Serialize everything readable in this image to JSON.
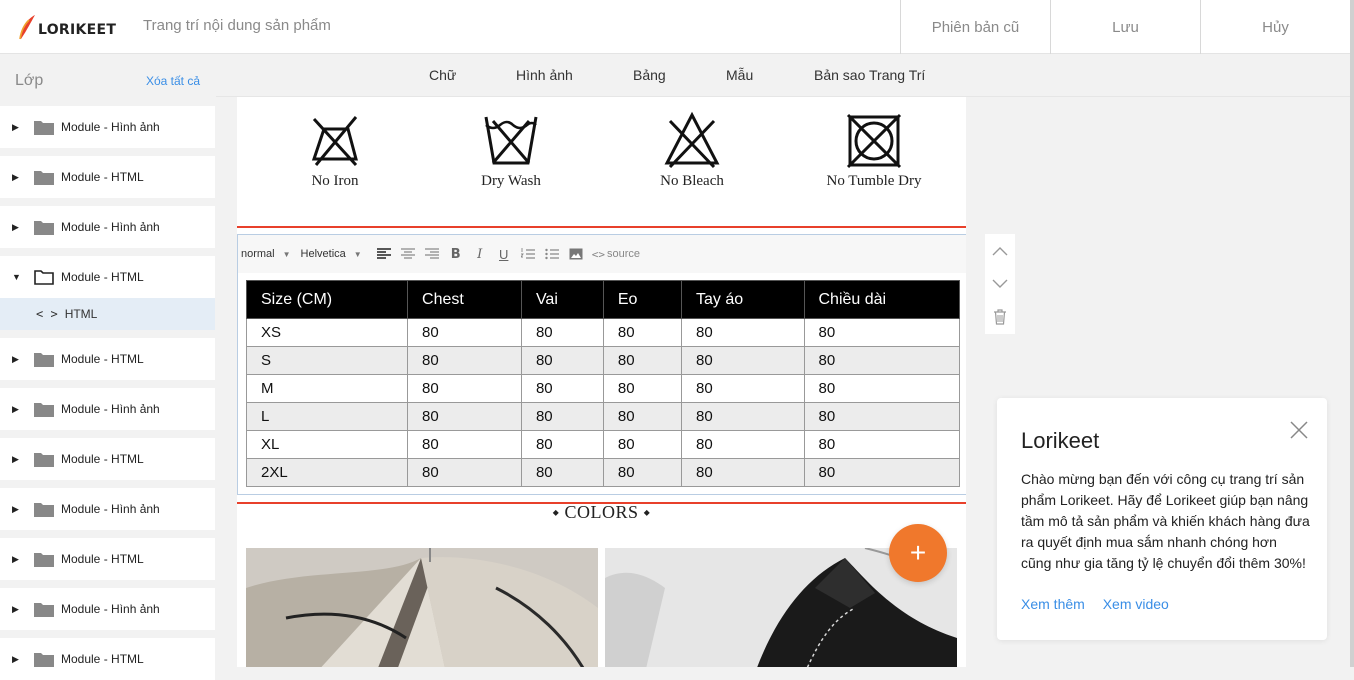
{
  "header": {
    "logo_text": "LORIKEET",
    "title": "Trang trí nội dung sản phẩm",
    "buttons": [
      "Phiên bản cũ",
      "Lưu",
      "Hủy"
    ]
  },
  "sidebar": {
    "title": "Lớp",
    "clear_all": "Xóa tất cả",
    "items": [
      {
        "label": "Module - Hình ảnh"
      },
      {
        "label": "Module - HTML"
      },
      {
        "label": "Module - Hình ảnh"
      },
      {
        "label": "Module - HTML",
        "child": "HTML"
      },
      {
        "label": "Module - HTML"
      },
      {
        "label": "Module - Hình ảnh"
      },
      {
        "label": "Module - HTML"
      },
      {
        "label": "Module - Hình ảnh"
      },
      {
        "label": "Module - HTML"
      },
      {
        "label": "Module - Hình ảnh"
      },
      {
        "label": "Module - HTML"
      }
    ]
  },
  "tabs": [
    "Chữ",
    "Hình ảnh",
    "Bảng",
    "Mẫu",
    "Bản sao Trang Trí"
  ],
  "care_labels": [
    "No Iron",
    "Dry Wash",
    "No Bleach",
    "No Tumble Dry"
  ],
  "editor": {
    "font_size": "normal",
    "font_family": "Helvetica",
    "source_label": "source"
  },
  "size_table": {
    "headers": [
      "Size (CM)",
      "Chest",
      "Vai",
      "Eo",
      "Tay áo",
      "Chiều dài"
    ],
    "rows": [
      [
        "XS",
        "80",
        "80",
        "80",
        "80",
        "80"
      ],
      [
        "S",
        "80",
        "80",
        "80",
        "80",
        "80"
      ],
      [
        "M",
        "80",
        "80",
        "80",
        "80",
        "80"
      ],
      [
        "L",
        "80",
        "80",
        "80",
        "80",
        "80"
      ],
      [
        "XL",
        "80",
        "80",
        "80",
        "80",
        "80"
      ],
      [
        "2XL",
        "80",
        "80",
        "80",
        "80",
        "80"
      ]
    ]
  },
  "colors_title": "⬩ COLORS ⬩",
  "fab_label": "+",
  "popup": {
    "title": "Lorikeet",
    "body": "Chào mừng bạn đến với công cụ trang trí sản phẩm Lorikeet. Hãy để Lorikeet giúp bạn nâng tầm mô tả sản phẩm và khiến khách hàng đưa ra quyết định mua sắm nhanh chóng hơn cũng như gia tăng tỷ lệ chuyển đổi thêm 30%!",
    "link_more": "Xem thêm",
    "link_video": "Xem video"
  },
  "colors": {
    "accent": "#f0782c",
    "link": "#3a8ee6",
    "selection": "#e8402b"
  }
}
